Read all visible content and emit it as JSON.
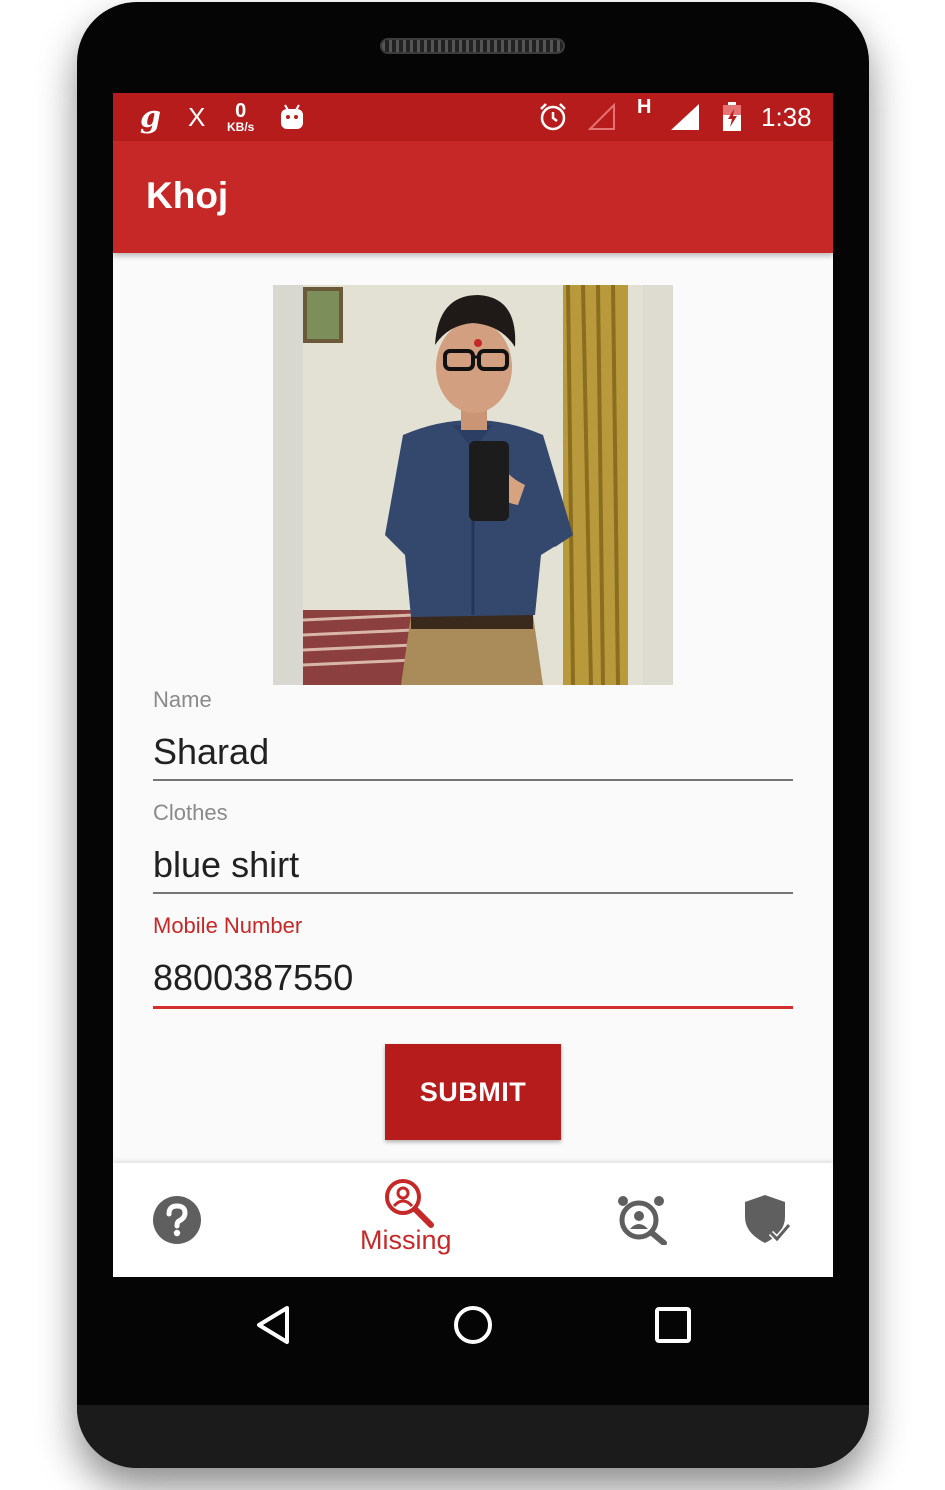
{
  "status_bar": {
    "app_glyph": "g",
    "x_glyph": "X",
    "speed_value": "0",
    "speed_unit": "KB/s",
    "network_type": "H",
    "time": "1:38",
    "icons": [
      "android-icon",
      "alarm-icon",
      "signal-empty-icon",
      "signal-full-icon",
      "battery-charging-icon"
    ]
  },
  "app_bar": {
    "title": "Khoj"
  },
  "form": {
    "name": {
      "label": "Name",
      "value": "Sharad"
    },
    "clothes": {
      "label": "Clothes",
      "value": "blue shirt"
    },
    "mobile": {
      "label": "Mobile Number",
      "value": "8800387550"
    },
    "submit_label": "SUBMIT"
  },
  "bottom_nav": {
    "items": [
      {
        "icon": "help-icon"
      },
      {
        "icon": "missing-search-icon",
        "label": "Missing",
        "active": true
      },
      {
        "icon": "found-person-icon"
      },
      {
        "icon": "shield-check-icon"
      }
    ]
  },
  "colors": {
    "status_bar": "#b71c1c",
    "app_bar": "#c62828",
    "accent": "#d32f2f",
    "icon_gray": "#5f5f5f"
  }
}
